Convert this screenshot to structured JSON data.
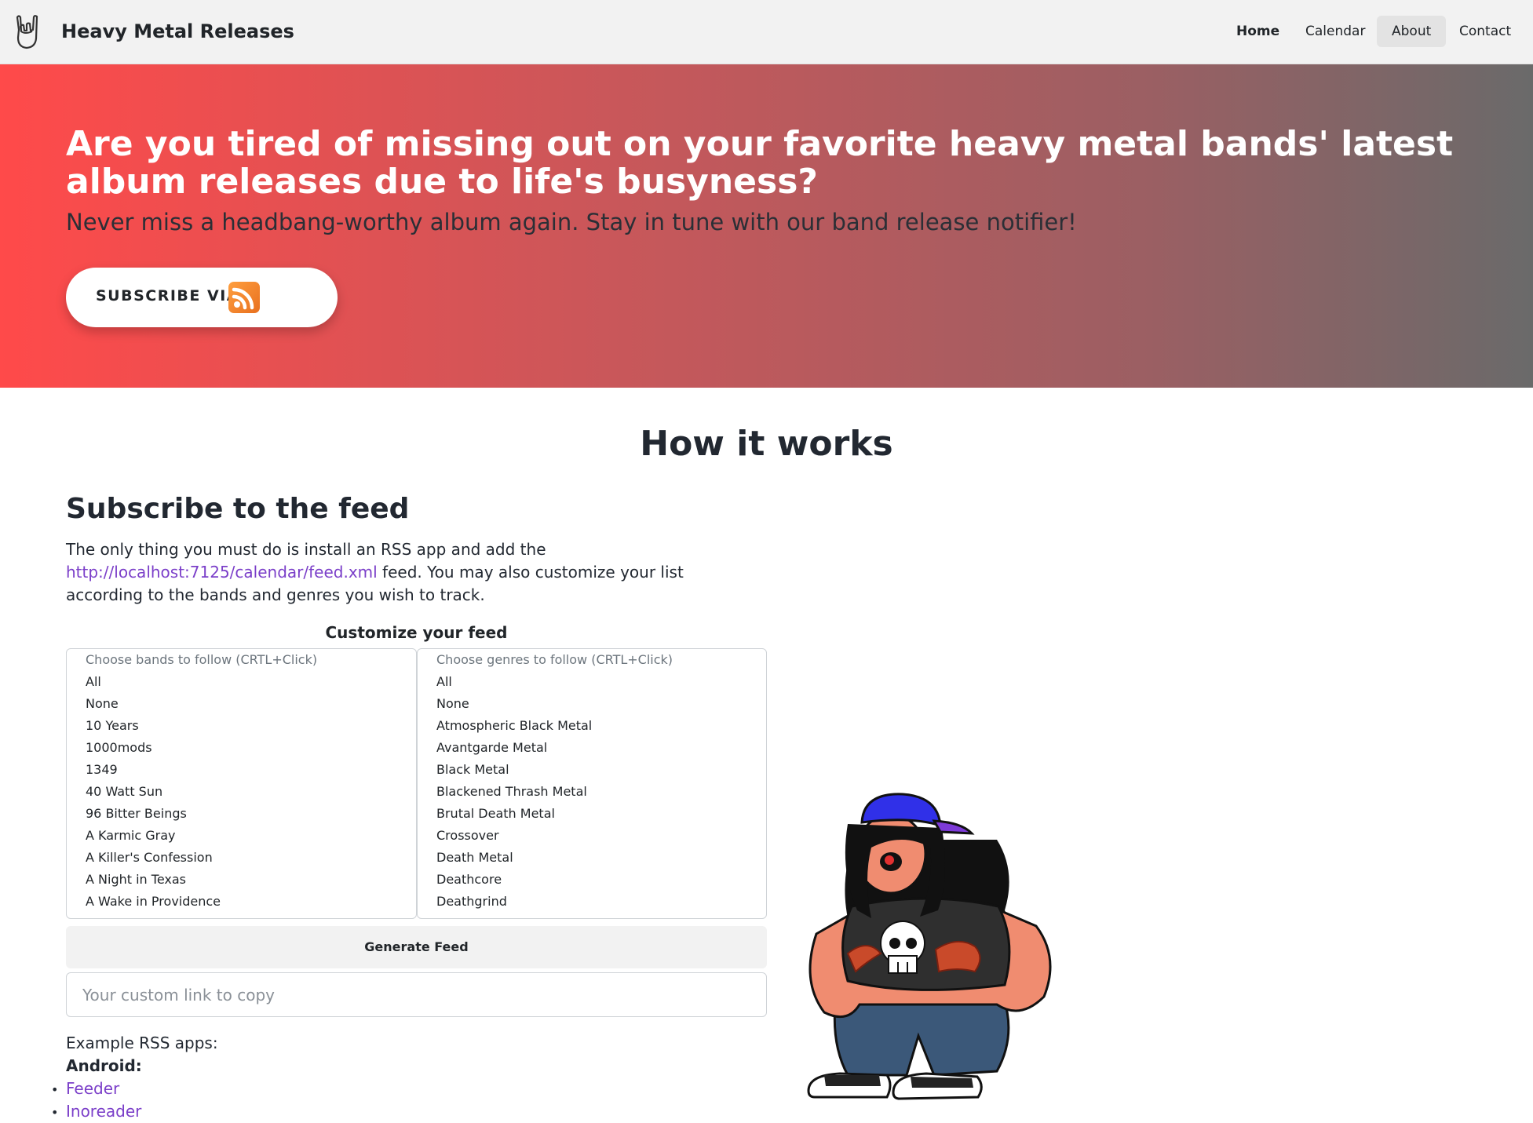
{
  "header": {
    "brand": "Heavy Metal Releases",
    "nav": {
      "home": "Home",
      "calendar": "Calendar",
      "about": "About",
      "contact": "Contact"
    }
  },
  "hero": {
    "title": "Are you tired of missing out on your favorite heavy metal bands' latest album releases due to life's busyness?",
    "subtitle": "Never miss a headbang-worthy album again. Stay in tune with our band release notifier!",
    "subscribe_label": "SUBSCRIBE VIA"
  },
  "main": {
    "how_title": "How it works",
    "subscribe_title": "Subscribe to the feed",
    "intro_before": "The only thing you must do is install an RSS app and add the ",
    "feed_link": "http://localhost:7125/calendar/feed.xml",
    "intro_after": " feed. You may also customize your list according to the bands and genres you wish to track.",
    "customize_title": "Customize your feed",
    "bands": {
      "placeholder": "Choose bands to follow (CRTL+Click)",
      "options": [
        "All",
        "None",
        "10 Years",
        "1000mods",
        "1349",
        "40 Watt Sun",
        "96 Bitter Beings",
        "A Karmic Gray",
        "A Killer's Confession",
        "A Night in Texas",
        "A Wake in Providence"
      ]
    },
    "genres": {
      "placeholder": "Choose genres to follow (CRTL+Click)",
      "options": [
        "All",
        "None",
        "Atmospheric Black Metal",
        "Avantgarde Metal",
        "Black Metal",
        "Blackened Thrash Metal",
        "Brutal Death Metal",
        "Crossover",
        "Death Metal",
        "Deathcore",
        "Deathgrind"
      ]
    },
    "generate_label": "Generate Feed",
    "link_placeholder": "Your custom link to copy",
    "examples_label": "Example RSS apps:",
    "android_label": "Android:",
    "apps": [
      "Feeder",
      "Inoreader"
    ]
  },
  "colors": {
    "hero_gradient_start": "#ff4a4a",
    "hero_gradient_end": "#6a6a6a",
    "link": "#7b3fc9",
    "rss_orange": "#f08a2c"
  },
  "icons": {
    "brand": "rock-hand-icon",
    "subscribe": "rss-icon",
    "illustration": "metalhead-mascot"
  }
}
